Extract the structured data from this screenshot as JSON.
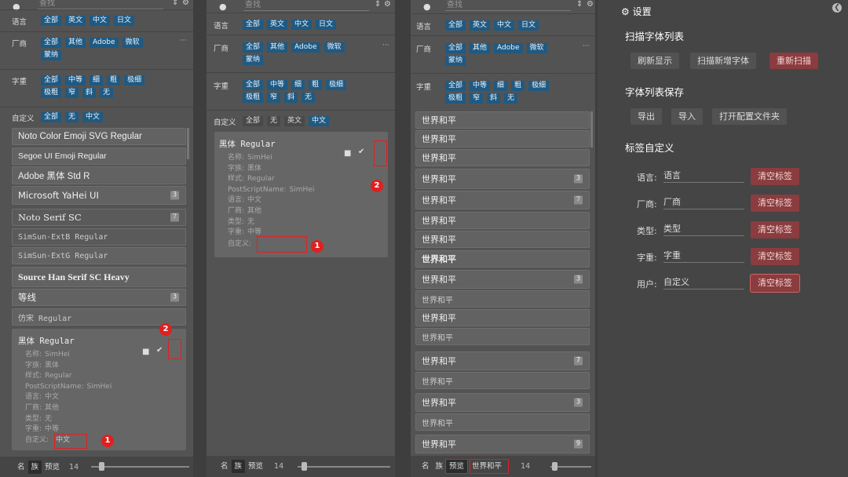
{
  "search": {
    "placeholder": "查找"
  },
  "filters": {
    "language": {
      "label": "语言",
      "chips": [
        "全部",
        "英文",
        "中文",
        "日文"
      ]
    },
    "vendor": {
      "label": "厂商",
      "chips": [
        "全部",
        "其他",
        "Adobe",
        "微软",
        "蒙纳"
      ],
      "more": "···"
    },
    "weight": {
      "label": "字重",
      "chips": [
        "全部",
        "中等",
        "细",
        "粗",
        "极细",
        "极粗",
        "窄",
        "斜",
        "无"
      ]
    },
    "custom": {
      "label": "自定义",
      "chips": [
        "全部",
        "无",
        "英文",
        "中文"
      ]
    }
  },
  "panel1": {
    "fonts": [
      {
        "name": "Noto Color Emoji SVG Regular",
        "badge": ""
      },
      {
        "name": "Segoe UI Emoji Regular",
        "badge": ""
      },
      {
        "name": "Adobe 黑体 Std R",
        "badge": ""
      },
      {
        "name": "Microsoft YaHei UI",
        "badge": "3"
      },
      {
        "name": "Noto Serif SC",
        "badge": "7"
      },
      {
        "name": "SimSun-ExtB Regular",
        "badge": ""
      },
      {
        "name": "SimSun-ExtG Regular",
        "badge": ""
      },
      {
        "name": "Source Han Serif SC Heavy",
        "badge": ""
      },
      {
        "name": "等线",
        "badge": "3"
      },
      {
        "name": "仿宋 Regular",
        "badge": ""
      }
    ]
  },
  "detail": {
    "title": "黑体 Regular",
    "rows": [
      {
        "k": "名称:",
        "v": "SimHei"
      },
      {
        "k": "字族:",
        "v": "黑体"
      },
      {
        "k": "样式:",
        "v": "Regular"
      },
      {
        "k": "PostScriptName:",
        "v": "SimHei"
      },
      {
        "k": "语言:",
        "v": "中文"
      },
      {
        "k": "厂商:",
        "v": "其他"
      },
      {
        "k": "类型:",
        "v": "无"
      },
      {
        "k": "字重:",
        "v": "中等"
      }
    ],
    "custom_label": "自定义:",
    "custom_value_p1": "中文",
    "custom_value_p2": ""
  },
  "annotations": {
    "one": "1",
    "two": "2"
  },
  "bottom": {
    "name": "名",
    "family": "族",
    "preview": "预览",
    "size": "14",
    "preview_text": "世界和平"
  },
  "panel3": {
    "preview_text": "世界和平",
    "badges": [
      "",
      "",
      "",
      "3",
      "7",
      "",
      "",
      "",
      "3",
      "",
      "",
      "",
      "7",
      "",
      "3",
      "",
      "9"
    ]
  },
  "settings": {
    "title": "设置",
    "scan_header": "扫描字体列表",
    "scan_buttons": [
      "刷新显示",
      "扫描新增字体",
      "重新扫描"
    ],
    "save_header": "字体列表保存",
    "save_buttons": [
      "导出",
      "导入",
      "打开配置文件夹"
    ],
    "tag_header": "标签自定义",
    "tags": [
      {
        "label": "语言:",
        "value": "语言",
        "button": "清空标签"
      },
      {
        "label": "厂商:",
        "value": "厂商",
        "button": "清空标签"
      },
      {
        "label": "类型:",
        "value": "类型",
        "button": "清空标签"
      },
      {
        "label": "字重:",
        "value": "字重",
        "button": "清空标签"
      },
      {
        "label": "用户:",
        "value": "自定义",
        "button": "清空标签"
      }
    ]
  },
  "colors": {
    "chip": "#1f5a83",
    "danger": "#8a3c3e",
    "annotation": "#e01f1f"
  }
}
